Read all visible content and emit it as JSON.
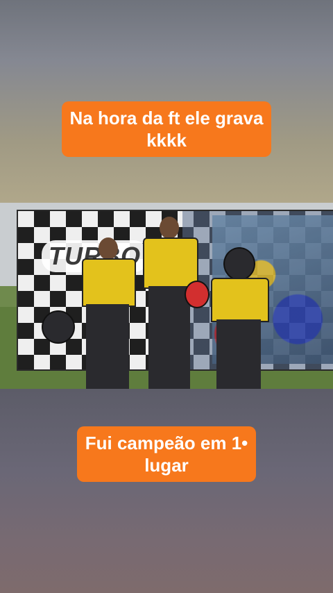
{
  "captions": {
    "top": {
      "line1": "Na hora da ft ele grava",
      "line2": "kkkk"
    },
    "bottom": {
      "line1": "Fui campeão em 1•",
      "line2": "lugar"
    }
  },
  "banner": {
    "logo_text": "TURBO"
  },
  "colors": {
    "caption_bg": "#f7781c",
    "caption_text": "#ffffff",
    "suit": "#e3c21c"
  }
}
